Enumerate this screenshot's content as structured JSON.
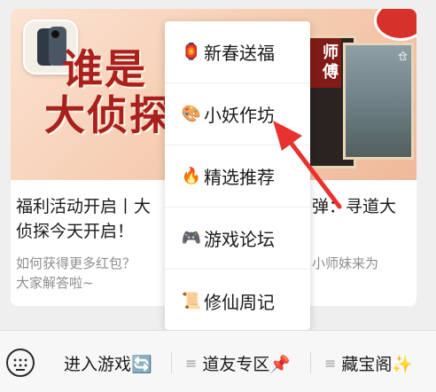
{
  "article_card": {
    "banner_title_line1": "谁是",
    "banner_title_line2": "大侦探",
    "banner_art_seal": "师傅",
    "headline_left": "福利活动开启丨大",
    "headline_right": "弹：寻道大",
    "headline_line2": "侦探今天开启！",
    "summary_left": "如何获得更多红包？",
    "summary_right": "小师妹来为",
    "summary_line2": "大家解答啦~"
  },
  "popup_menu": {
    "items": [
      {
        "icon": "🏮",
        "icon_name": "lantern-icon",
        "label": "新春送福"
      },
      {
        "icon": "🎨",
        "icon_name": "palette-icon",
        "label": "小妖作坊"
      },
      {
        "icon": "🔥",
        "icon_name": "fire-icon",
        "label": "精选推荐"
      },
      {
        "icon": "🎮",
        "icon_name": "gamepad-icon",
        "label": "游戏论坛"
      },
      {
        "icon": "📜",
        "icon_name": "scroll-icon",
        "label": "修仙周记"
      }
    ]
  },
  "bottom_bar": {
    "enter_game": "进入游戏🔄",
    "friends_zone": "道友专区📌",
    "treasure": "藏宝阁✨",
    "menu_glyph": "≡"
  },
  "colors": {
    "annotation_arrow": "#e8322e",
    "banner_title": "#a9201d"
  }
}
